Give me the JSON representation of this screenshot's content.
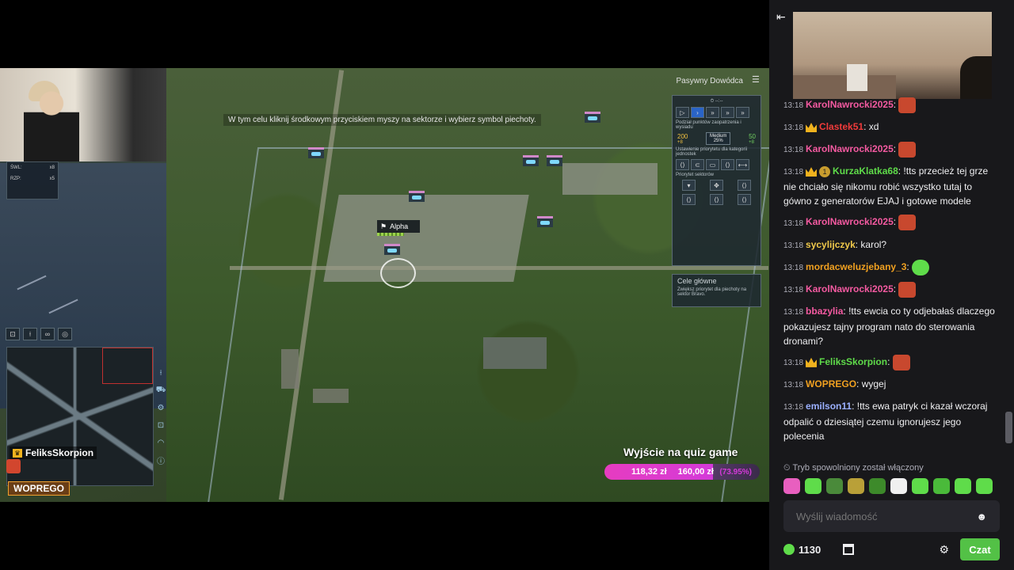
{
  "game": {
    "tooltip": "W tym celu kliknij środkowym przyciskiem myszy na sektorze i wybierz symbol piechoty.",
    "commander_mode": "Pasywny Dowódca",
    "unit_label": "Alpha",
    "hud_left": {
      "row1_label": "ŚWL:",
      "row1_value": "x8",
      "row2_label": "RZP:",
      "row2_value": "x5"
    },
    "panel": {
      "clock": "--:--",
      "supply_title": "Podział punktów zaopatrzenia i wysiadu",
      "left_value": "200",
      "left_delta": "+8",
      "medium_label": "Medium",
      "medium_pct": "25%",
      "right_value": "50",
      "right_delta": "+8",
      "priority_label": "Ustawienie priorytetu dla kategorii jednostek",
      "sector_label": "Priorytet sektorów"
    },
    "goals": {
      "title": "Cele główne",
      "desc": "Zwiększ priorytet dla piechoty na sektor Bravo."
    },
    "quiz": {
      "title": "Wyjście na quiz game",
      "current": "118,32 zł",
      "target": "160,00 zł",
      "percent": "(73.95%)"
    },
    "badge_user": "FeliksSkorpion",
    "badge_user2": "WOPREGO"
  },
  "chat": {
    "messages": [
      {
        "time": "13:18",
        "user": "KarolNawrocki2025",
        "color": "#f45aa1",
        "crown": false,
        "text": "",
        "emote": "red"
      },
      {
        "time": "13:18",
        "user": "Clastek51",
        "color": "#f23b3b",
        "crown": true,
        "text": "xd",
        "emote": ""
      },
      {
        "time": "13:18",
        "user": "KarolNawrocki2025",
        "color": "#f45aa1",
        "crown": false,
        "text": "",
        "emote": "red"
      },
      {
        "time": "13:18",
        "user": "KurzaKlatka68",
        "color": "#5fdc4a",
        "crown": true,
        "num": "1",
        "text": "!tts przecież tej grze nie chciało się nikomu robić wszystko tutaj to gówno z generatorów EJAJ i gotowe modele",
        "emote": ""
      },
      {
        "time": "13:18",
        "user": "KarolNawrocki2025",
        "color": "#f45aa1",
        "crown": false,
        "text": "",
        "emote": "red"
      },
      {
        "time": "13:18",
        "user": "sycylijczyk",
        "color": "#f0c94a",
        "crown": false,
        "text": "karol?",
        "emote": ""
      },
      {
        "time": "13:18",
        "user": "mordacweluzjebany_3",
        "color": "#f0a020",
        "crown": false,
        "text": "",
        "emote": "green"
      },
      {
        "time": "13:18",
        "user": "KarolNawrocki2025",
        "color": "#f45aa1",
        "crown": false,
        "text": "",
        "emote": "red"
      },
      {
        "time": "13:18",
        "user": "bbazylia",
        "color": "#f45aa1",
        "crown": false,
        "text": "!tts ewcia co ty odjebałaś dlaczego pokazujesz tajny program nato do sterowania dronami?",
        "emote": ""
      },
      {
        "time": "13:18",
        "user": "FeliksSkorpion",
        "color": "#5fdc4a",
        "crown": true,
        "text": "",
        "emote": "red"
      },
      {
        "time": "13:18",
        "user": "WOPREGO",
        "color": "#f0a020",
        "crown": false,
        "text": "wygej",
        "emote": ""
      },
      {
        "time": "13:18",
        "user": "emilson11",
        "color": "#9bb0ff",
        "crown": false,
        "text": "!tts ewa patryk ci kazał wczoraj odpalić o dziesiątej czemu ignorujesz jego polecenia",
        "emote": ""
      }
    ],
    "slowmode": "Tryb spowolniony został włączony",
    "input_placeholder": "Wyślij wiadomość",
    "points": "1130",
    "send_label": "Czat",
    "emote_row": [
      {
        "color": "#e85fbf"
      },
      {
        "color": "#5fdc4a"
      },
      {
        "color": "#4a8a3a"
      },
      {
        "color": "#b9a038"
      },
      {
        "color": "#3d8a2a"
      },
      {
        "color": "#f0f0f0"
      },
      {
        "color": "#5fdc4a"
      },
      {
        "color": "#4aba3a"
      },
      {
        "color": "#5fdc4a"
      },
      {
        "color": "#5fdc4a"
      }
    ]
  }
}
